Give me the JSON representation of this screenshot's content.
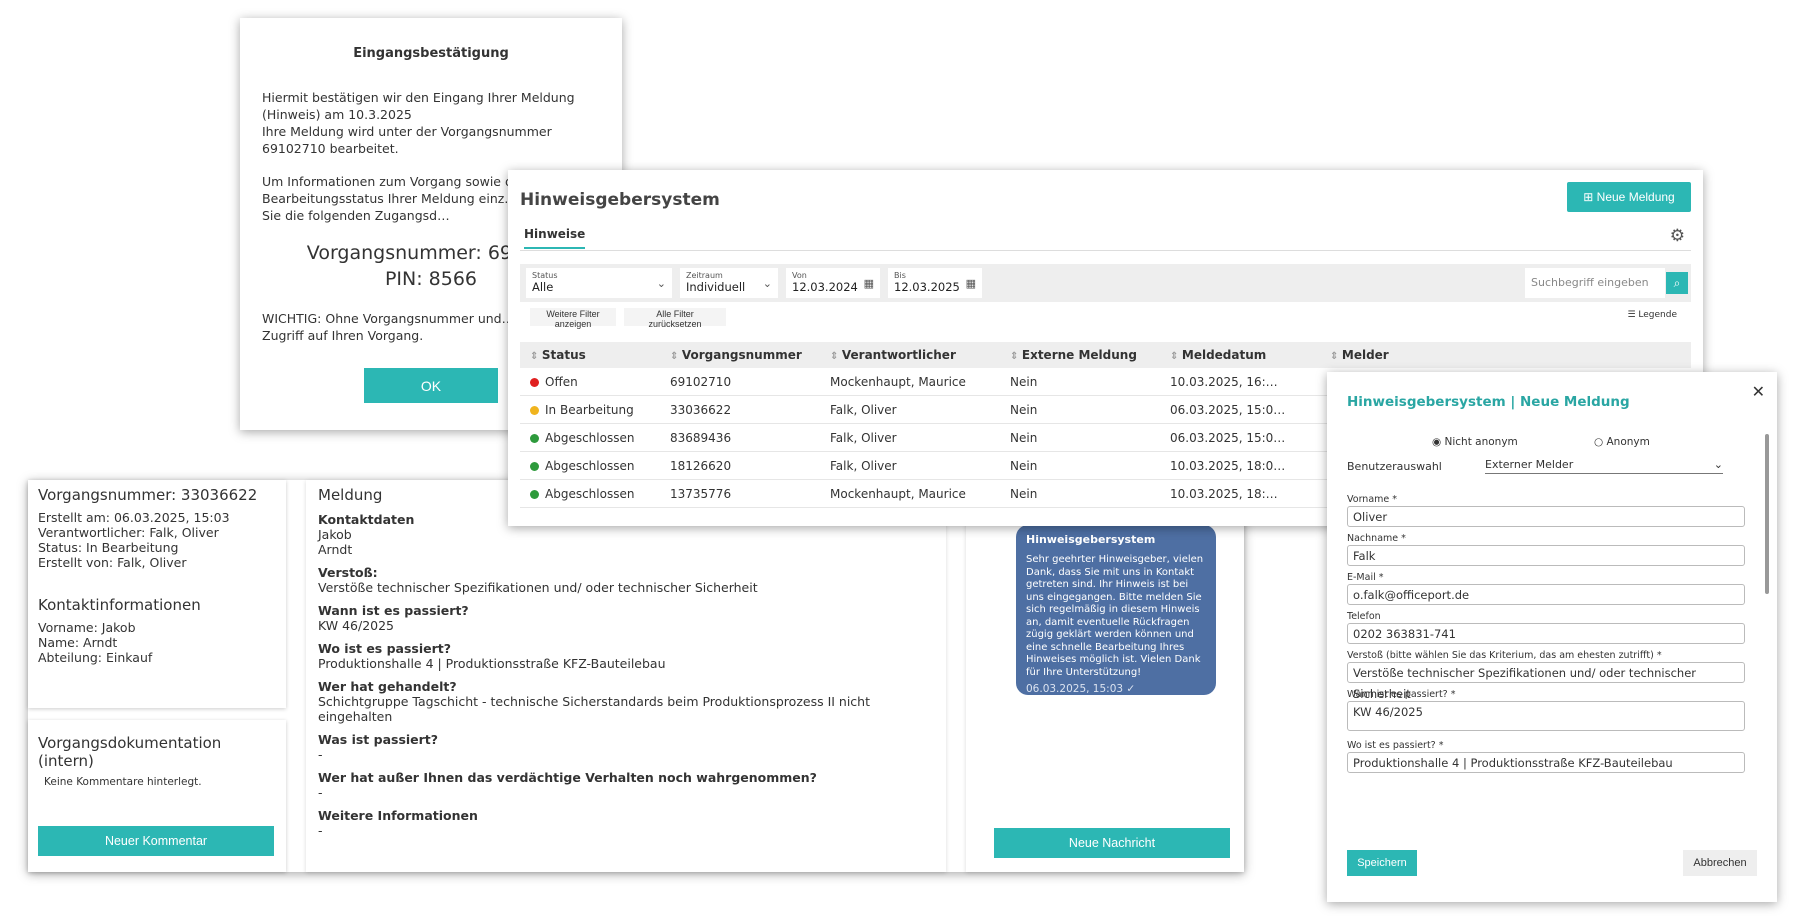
{
  "confirm": {
    "title": "Eingangsbestätigung",
    "p1": "Hiermit bestätigen wir den Eingang Ihrer Meldung (Hinweis) am 10.3.2025",
    "p2": "Ihre Meldung wird unter der Vorgangsnummer 69102710 bearbeitet.",
    "p3": "Um Informationen zum Vorgang sowie d… Bearbeitungsstatus Ihrer Meldung einz… verwenden Sie die folgenden Zugangsd…",
    "case_line": "Vorgangsnummer: 6910…",
    "pin_line": "PIN: 8566",
    "warning": "WICHTIG: Ohne Vorgangsnummer und… Sie keinen Zugriff auf Ihren Vorgang.",
    "ok": "OK"
  },
  "detail": {
    "case_title": "Vorgangsnummer: 33036622",
    "info": [
      "Erstellt am: 06.03.2025, 15:03",
      "Verantwortlicher: Falk, Oliver",
      "Status: In Bearbeitung",
      "Erstellt von: Falk, Oliver"
    ],
    "contact_title": "Kontaktinformationen",
    "contact": [
      "Vorname: Jakob",
      "Name: Arndt",
      "Abteilung: Einkauf"
    ],
    "doc_title": "Vorgangsdokumentation (intern)",
    "doc_empty": "Keine Kommentare hinterlegt.",
    "comment_btn": "Neuer Kommentar",
    "report_title": "Meldung",
    "qa": [
      {
        "q": "Kontaktdaten",
        "a": "Jakob"
      },
      {
        "q": "",
        "a": "Arndt"
      },
      {
        "q": "Verstoß:",
        "a": "Verstöße technischer Spezifikationen und/ oder technischer Sicherheit"
      },
      {
        "q": "Wann ist es passiert?",
        "a": "KW 46/2025"
      },
      {
        "q": "Wo ist es passiert?",
        "a": "Produktionshalle 4 | Produktionsstraße KFZ-Bauteilebau"
      },
      {
        "q": "Wer hat gehandelt?",
        "a": "Schichtgruppe Tagschicht - technische Sicherstandards beim Produktionsprozess II nicht eingehalten"
      },
      {
        "q": "Was ist passiert?",
        "a": "-"
      },
      {
        "q": "Wer hat außer Ihnen das verdächtige Verhalten noch wahrgenommen?",
        "a": "-"
      },
      {
        "q": "Weitere Informationen",
        "a": "-"
      }
    ],
    "msg_title": "Hinweisgebersystem",
    "msg_text": "Sehr geehrter Hinweisgeber, vielen Dank, dass Sie mit uns in Kontakt getreten sind. Ihr Hinweis ist bei uns eingegangen. Bitte melden Sie sich regelmäßig in diesem Hinweis an, damit eventuelle Rückfragen zügig geklärt werden können und eine schnelle Bearbeitung Ihres Hinweises möglich ist. Vielen Dank für Ihre Unterstützung!",
    "msg_date": "06.03.2025, 15:03 ✓",
    "msg_btn": "Neue Nachricht"
  },
  "main": {
    "title": "Hinweisgebersystem",
    "new_btn": "Neue Meldung",
    "tab": "Hinweise",
    "filters": {
      "status_label": "Status",
      "status_value": "Alle",
      "range_label": "Zeitraum",
      "range_value": "Individuell",
      "from_label": "Von",
      "from_value": "12.03.2024",
      "to_label": "Bis",
      "to_value": "12.03.2025",
      "search_placeholder": "Suchbegriff eingeben",
      "more": "Weitere Filter anzeigen",
      "reset": "Alle Filter zurücksetzen",
      "legend": "Legende"
    },
    "columns": [
      "Status",
      "Vorgangsnummer",
      "Verantwortlicher",
      "Externe Meldung",
      "Meldedatum",
      "Melder"
    ],
    "rows": [
      {
        "status": "Offen",
        "color": "#e02020",
        "nr": "69102710",
        "resp": "Mockenhaupt, Maurice",
        "ext": "Nein",
        "date": "10.03.2025, 16:…"
      },
      {
        "status": "In Bearbeitung",
        "color": "#f0b41e",
        "nr": "33036622",
        "resp": "Falk, Oliver",
        "ext": "Nein",
        "date": "06.03.2025, 15:0…"
      },
      {
        "status": "Abgeschlossen",
        "color": "#2e9a3c",
        "nr": "83689436",
        "resp": "Falk, Oliver",
        "ext": "Nein",
        "date": "06.03.2025, 15:0…"
      },
      {
        "status": "Abgeschlossen",
        "color": "#2e9a3c",
        "nr": "18126620",
        "resp": "Falk, Oliver",
        "ext": "Nein",
        "date": "10.03.2025, 18:0…"
      },
      {
        "status": "Abgeschlossen",
        "color": "#2e9a3c",
        "nr": "13735776",
        "resp": "Mockenhaupt, Maurice",
        "ext": "Nein",
        "date": "10.03.2025, 18:…"
      }
    ]
  },
  "form": {
    "title": "Hinweisgebersystem | Neue Meldung",
    "radio_named": "Nicht anonym",
    "radio_anon": "Anonym",
    "user_label": "Benutzerauswahl",
    "user_value": "Externer Melder",
    "fields": [
      {
        "label": "Vorname *",
        "value": "Oliver"
      },
      {
        "label": "Nachname *",
        "value": "Falk"
      },
      {
        "label": "E-Mail *",
        "value": "o.falk@officeport.de"
      },
      {
        "label": "Telefon",
        "value": "0202 363831-741"
      },
      {
        "label": "Verstoß (bitte wählen Sie das Kriterium, das am ehesten zutrifft) *",
        "value": "Verstöße technischer Spezifikationen und/ oder technischer Sicherheit"
      },
      {
        "label": "Wann ist es passiert? *",
        "value": "KW 46/2025"
      },
      {
        "label": "Wo ist es passiert? *",
        "value": "Produktionshalle 4 | Produktionsstraße KFZ-Bauteilebau"
      }
    ],
    "save": "Speichern",
    "cancel": "Abbrechen"
  },
  "colors": {
    "accent": "#2cb7b4",
    "bubble": "#4e6fa3"
  }
}
